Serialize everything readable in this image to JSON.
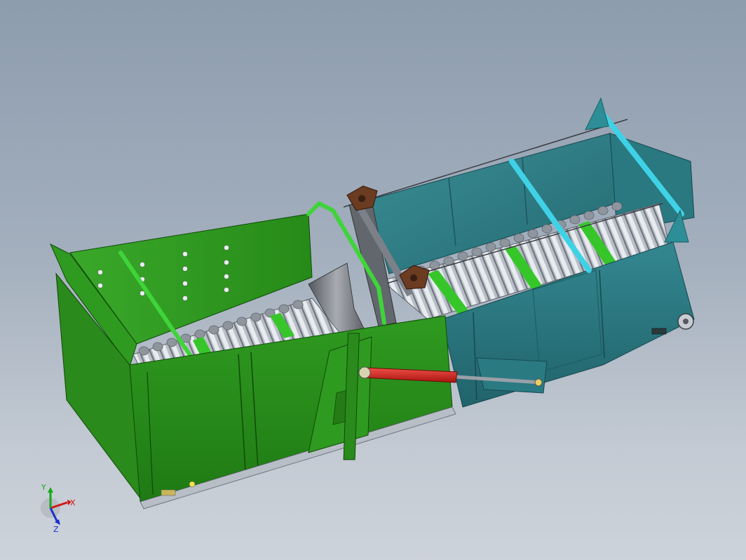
{
  "viewport": {
    "background_top": "#8d9cae",
    "background_bottom": "#cdd3da"
  },
  "model": {
    "parts": [
      {
        "name": "front-hopper-section",
        "color": "#2b8a1c"
      },
      {
        "name": "rear-hopper-section",
        "color": "#2f7f86"
      },
      {
        "name": "roller-conveyor-bed",
        "color": "#c9ced6"
      },
      {
        "name": "hydraulic-cylinder",
        "color": "#d42a22"
      },
      {
        "name": "support-rod-cyan",
        "color": "#3fd2e6"
      },
      {
        "name": "support-rod-green",
        "color": "#3fd43a"
      },
      {
        "name": "bearing-flange",
        "color": "#6b3b22"
      }
    ]
  },
  "triad": {
    "x_label": "X",
    "y_label": "Y",
    "z_label": "Z",
    "x_color": "#d01818",
    "y_color": "#18a818",
    "z_color": "#1830d0"
  }
}
